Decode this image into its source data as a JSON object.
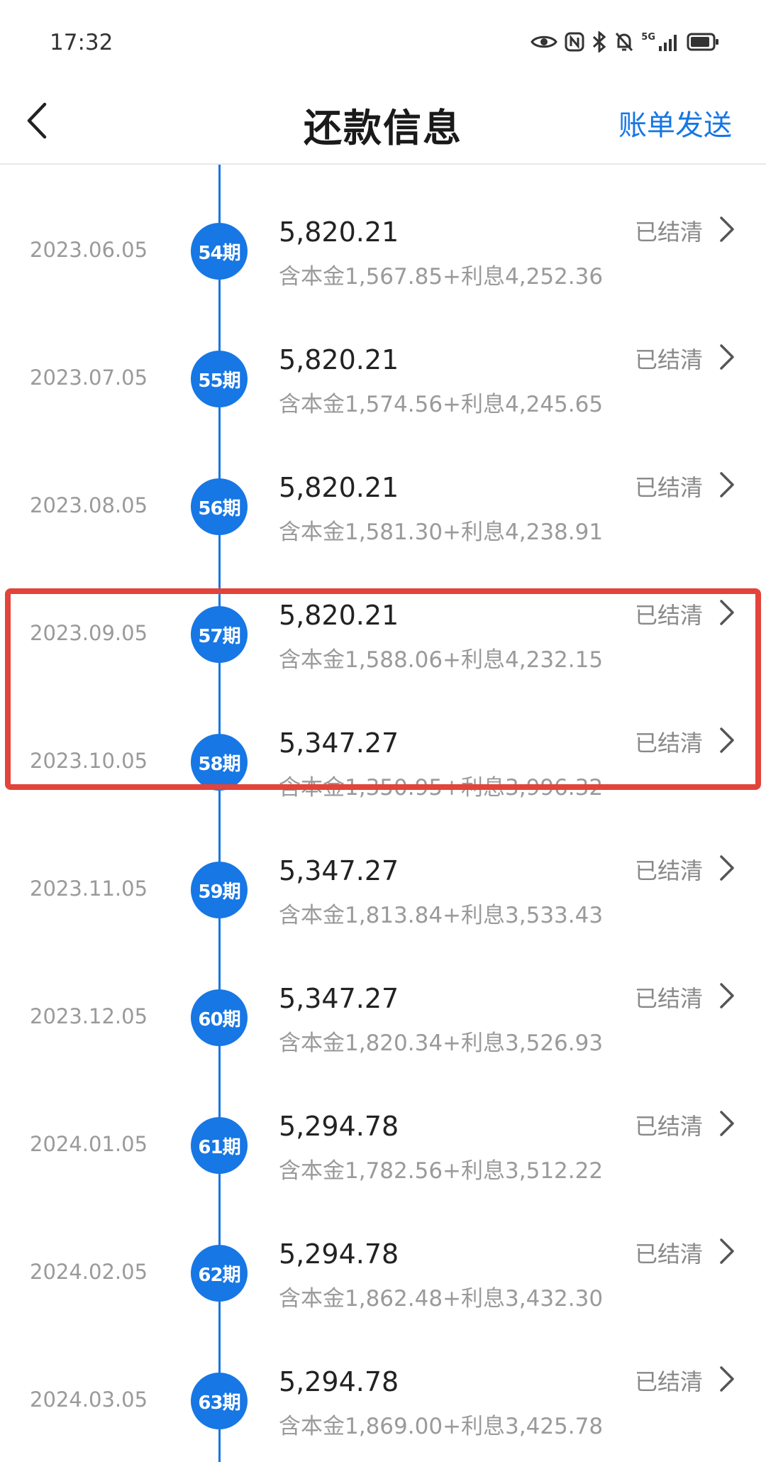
{
  "status_bar": {
    "time": "17:32",
    "signal_label": "5G",
    "icons": [
      "eye-icon",
      "nfc-icon",
      "bluetooth-icon",
      "mute-icon",
      "signal-icon",
      "battery-icon"
    ]
  },
  "header": {
    "title": "还款信息",
    "action_label": "账单发送",
    "back_icon": "chevron-left-icon"
  },
  "colors": {
    "accent": "#1677e5",
    "highlight": "#e2433a",
    "muted_text": "#9a9a9a"
  },
  "highlight": {
    "covers_periods": [
      "57期",
      "58期"
    ]
  },
  "items": [
    {
      "date": "2023.06.05",
      "period": "54期",
      "amount": "5,820.21",
      "detail": "含本金1,567.85+利息4,252.36",
      "status": "已结清"
    },
    {
      "date": "2023.07.05",
      "period": "55期",
      "amount": "5,820.21",
      "detail": "含本金1,574.56+利息4,245.65",
      "status": "已结清"
    },
    {
      "date": "2023.08.05",
      "period": "56期",
      "amount": "5,820.21",
      "detail": "含本金1,581.30+利息4,238.91",
      "status": "已结清"
    },
    {
      "date": "2023.09.05",
      "period": "57期",
      "amount": "5,820.21",
      "detail": "含本金1,588.06+利息4,232.15",
      "status": "已结清"
    },
    {
      "date": "2023.10.05",
      "period": "58期",
      "amount": "5,347.27",
      "detail": "含本金1,350.95+利息3,996.32",
      "status": "已结清"
    },
    {
      "date": "2023.11.05",
      "period": "59期",
      "amount": "5,347.27",
      "detail": "含本金1,813.84+利息3,533.43",
      "status": "已结清"
    },
    {
      "date": "2023.12.05",
      "period": "60期",
      "amount": "5,347.27",
      "detail": "含本金1,820.34+利息3,526.93",
      "status": "已结清"
    },
    {
      "date": "2024.01.05",
      "period": "61期",
      "amount": "5,294.78",
      "detail": "含本金1,782.56+利息3,512.22",
      "status": "已结清"
    },
    {
      "date": "2024.02.05",
      "period": "62期",
      "amount": "5,294.78",
      "detail": "含本金1,862.48+利息3,432.30",
      "status": "已结清"
    },
    {
      "date": "2024.03.05",
      "period": "63期",
      "amount": "5,294.78",
      "detail": "含本金1,869.00+利息3,425.78",
      "status": "已结清"
    }
  ]
}
